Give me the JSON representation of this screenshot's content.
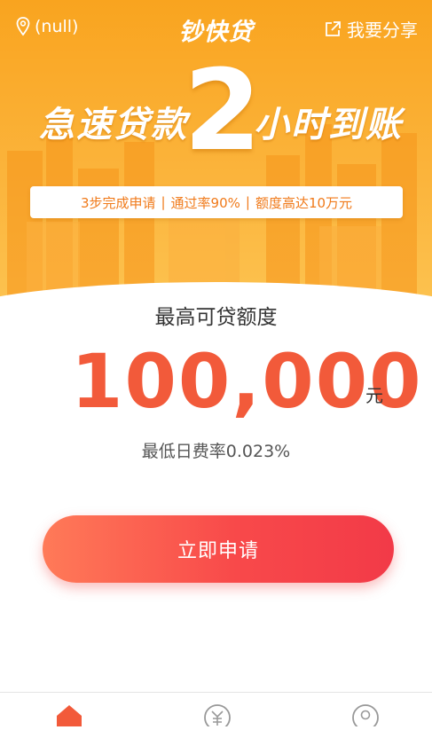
{
  "header": {
    "location": "(null)",
    "brand": "钞快贷",
    "share_label": "我要分享"
  },
  "banner": {
    "slogan_left": "急速贷款",
    "slogan_number": "2",
    "slogan_right": "小时到账",
    "features": [
      "3步完成申请",
      "通过率90%",
      "额度高达10万元"
    ]
  },
  "loan": {
    "label": "最高可贷额度",
    "amount": "100,000",
    "unit": "元",
    "rate": "最低日费率0.023%"
  },
  "apply_button": {
    "label": "立即申请"
  },
  "tabbar": {
    "tabs": [
      {
        "icon": "home-icon",
        "active": true
      },
      {
        "icon": "yuan-icon",
        "active": false
      },
      {
        "icon": "user-icon",
        "active": false
      }
    ]
  },
  "colors": {
    "banner": "#f9a41f",
    "amount": "#f25a3a",
    "button": "#f8494a",
    "features_text": "#f07a1a"
  }
}
